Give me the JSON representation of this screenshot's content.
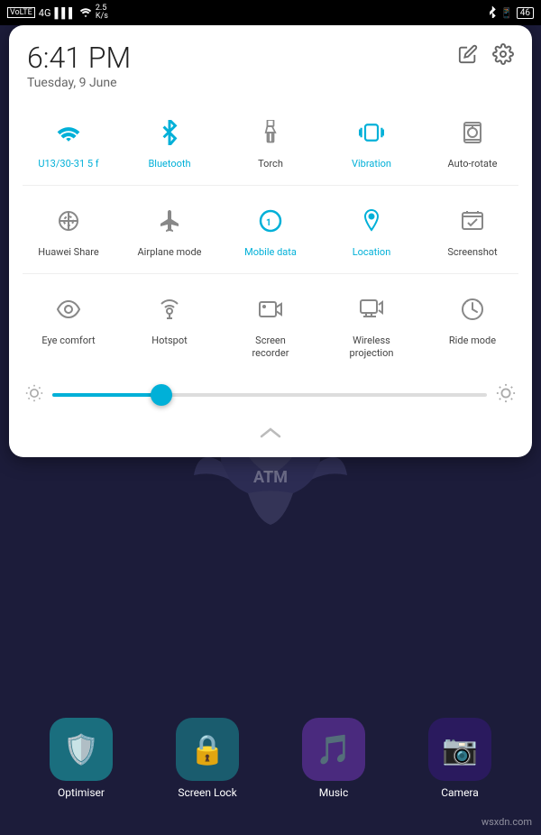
{
  "status_bar": {
    "left": {
      "volte": "VoLTE",
      "signal": "4G",
      "bars": "▌▌▌",
      "wifi": "WiFi",
      "speed": "2.5\nK/s"
    },
    "right": {
      "bluetooth": "BT",
      "device": "📱",
      "battery": "46"
    }
  },
  "panel": {
    "time": "6:41 PM",
    "date": "Tuesday, 9 June",
    "edit_label": "✏",
    "settings_label": "⚙",
    "rows": [
      {
        "items": [
          {
            "id": "wifi",
            "label": "U13/30-31 5 f",
            "active": true
          },
          {
            "id": "bluetooth",
            "label": "Bluetooth",
            "active": true
          },
          {
            "id": "torch",
            "label": "Torch",
            "active": false
          },
          {
            "id": "vibration",
            "label": "Vibration",
            "active": true
          },
          {
            "id": "autorotate",
            "label": "Auto-rotate",
            "active": false
          }
        ]
      },
      {
        "items": [
          {
            "id": "huaweishare",
            "label": "Huawei Share",
            "active": false
          },
          {
            "id": "airplane",
            "label": "Airplane mode",
            "active": false
          },
          {
            "id": "mobiledata",
            "label": "Mobile data",
            "active": true
          },
          {
            "id": "location",
            "label": "Location",
            "active": true
          },
          {
            "id": "screenshot",
            "label": "Screenshot",
            "active": false
          }
        ]
      },
      {
        "items": [
          {
            "id": "eyecomfort",
            "label": "Eye comfort",
            "active": false
          },
          {
            "id": "hotspot",
            "label": "Hotspot",
            "active": false
          },
          {
            "id": "screenrecorder",
            "label": "Screen\nrecorder",
            "active": false
          },
          {
            "id": "wirelessprojection",
            "label": "Wireless\nprojection",
            "active": false
          },
          {
            "id": "ridemode",
            "label": "Ride mode",
            "active": false
          }
        ]
      }
    ],
    "brightness": {
      "value": 25
    }
  },
  "apps": [
    {
      "id": "optimiser",
      "label": "Optimiser",
      "bg": "#1a6e7e",
      "icon": "🛡️"
    },
    {
      "id": "screenlock",
      "label": "Screen Lock",
      "bg": "#1a5c6e",
      "icon": "🔒"
    },
    {
      "id": "music",
      "label": "Music",
      "bg": "#4a2a7e",
      "icon": "🎵"
    },
    {
      "id": "camera",
      "label": "Camera",
      "bg": "#2a1a5e",
      "icon": "📷"
    }
  ],
  "watermark": "wsxdn.com"
}
